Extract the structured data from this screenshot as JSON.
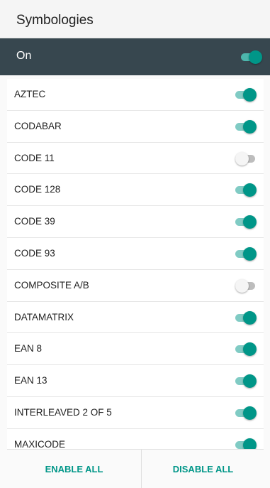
{
  "header": {
    "title": "Symbologies"
  },
  "master": {
    "label": "On",
    "enabled": true
  },
  "colors": {
    "accent": "#009688",
    "master_bar": "#37474f"
  },
  "symbologies": [
    {
      "label": "AZTEC",
      "enabled": true
    },
    {
      "label": "CODABAR",
      "enabled": true
    },
    {
      "label": "CODE 11",
      "enabled": false
    },
    {
      "label": "CODE 128",
      "enabled": true
    },
    {
      "label": "CODE 39",
      "enabled": true
    },
    {
      "label": "CODE 93",
      "enabled": true
    },
    {
      "label": "COMPOSITE A/B",
      "enabled": false
    },
    {
      "label": "DATAMATRIX",
      "enabled": true
    },
    {
      "label": "EAN 8",
      "enabled": true
    },
    {
      "label": "EAN 13",
      "enabled": true
    },
    {
      "label": "INTERLEAVED 2 OF 5",
      "enabled": true
    },
    {
      "label": "MAXICODE",
      "enabled": true
    }
  ],
  "footer": {
    "enable_all_label": "ENABLE ALL",
    "disable_all_label": "DISABLE ALL"
  }
}
